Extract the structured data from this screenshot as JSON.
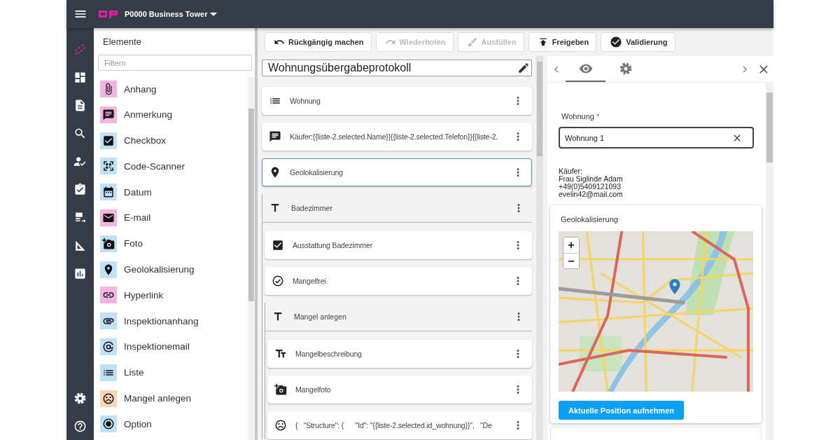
{
  "topbar": {
    "project": "P0000 Business Tower"
  },
  "rail": {
    "items": [
      {
        "kind": "elements",
        "selected": true
      },
      {
        "kind": "dashboard",
        "selected": false
      },
      {
        "kind": "document",
        "selected": false
      },
      {
        "kind": "search-doc",
        "selected": false
      },
      {
        "kind": "person-check",
        "selected": false
      },
      {
        "kind": "clipboard-check",
        "selected": false
      },
      {
        "kind": "list-export",
        "selected": false
      },
      {
        "kind": "ruler",
        "selected": false
      },
      {
        "kind": "chart",
        "selected": false
      }
    ],
    "bottom": [
      {
        "kind": "settings",
        "selected": false
      },
      {
        "kind": "help",
        "selected": false
      }
    ]
  },
  "palette": {
    "title": "Elemente",
    "filter_placeholder": "Filtern",
    "items": [
      {
        "kind": "attach",
        "label": "Anhang",
        "color": "#f4b4e0"
      },
      {
        "kind": "comment",
        "label": "Anmerkung",
        "color": "#f4b4e0"
      },
      {
        "kind": "checkbox",
        "label": "Checkbox",
        "color": "#bfe2fa"
      },
      {
        "kind": "qr",
        "label": "Code-Scanner",
        "color": "#bfe2fa"
      },
      {
        "kind": "calendar",
        "label": "Datum",
        "color": "#bfe2fa"
      },
      {
        "kind": "mail",
        "label": "E-mail",
        "color": "#f4b4e0"
      },
      {
        "label": "Foto",
        "color": "#bfe2fa"
      },
      {
        "kind": "location",
        "label": "Geolokalisierung",
        "color": "#bfe2fa"
      },
      {
        "kind": "link",
        "label": "Hyperlink",
        "color": "#f4b4e0"
      },
      {
        "kind": "attach2",
        "label": "Inspektionanhang",
        "color": "#bfe2fa"
      },
      {
        "kind": "at",
        "label": "Inspektionemail",
        "color": "#bfe2fa"
      },
      {
        "kind": "list",
        "label": "Liste",
        "color": "#bfe2fa"
      },
      {
        "kind": "sad",
        "label": "Mangel anlegen",
        "color": "#ffd4b6"
      },
      {
        "kind": "radio",
        "label": "Option",
        "color": "#bfe2fa"
      }
    ]
  },
  "toolbar": [
    {
      "kind": "undo",
      "label": "Rückgängig machen",
      "disabled": false
    },
    {
      "kind": "redo",
      "label": "Wiederholen",
      "disabled": true
    },
    {
      "kind": "fill",
      "label": "Ausfüllen",
      "disabled": true
    },
    {
      "kind": "publish",
      "label": "Freigeben",
      "disabled": false
    },
    {
      "kind": "validate",
      "label": "Validierung",
      "disabled": false
    }
  ],
  "editor": {
    "form_title": "Wohnungsübergabeprotokoll",
    "fields": [
      {
        "kind": "list",
        "label": "Wohnung",
        "selected": false
      },
      {
        "kind": "comment",
        "label": "Käufer:{{liste-2.selected.Name}}{{liste-2.selected.Telefon}}{{liste-2.",
        "selected": false
      },
      {
        "kind": "location",
        "label": "Geolokalisierung",
        "selected": true
      },
      {
        "kind": "title",
        "label": "Badezimmer",
        "selected": false,
        "children": [
          {
            "kind": "checkbox",
            "label": "Ausstattung Badezimmer",
            "selected": false
          },
          {
            "kind": "check",
            "label": "Mangelfrei",
            "selected": false
          },
          {
            "kind": "title",
            "label": "Mangel anlegen",
            "selected": false,
            "children": [
              {
                "kind": "text",
                "label": "Mangelbeschreibung",
                "selected": false
              },
              {
                "label": "Mangelfoto",
                "selected": false
              },
              {
                "kind": "sad",
                "label": "{   \"Structure\": {      \"Id\": \"{{liste-2.selected.id_wohnung}}\",   \"De",
                "selected": false
              }
            ]
          }
        ]
      }
    ]
  },
  "preview": {
    "tabs": [
      {
        "kind": "eye",
        "selected": true
      },
      {
        "kind": "settings",
        "selected": false
      }
    ],
    "field": {
      "label": "Wohnung",
      "required_mark": "*",
      "value": "Wohnung 1"
    },
    "buyer_info": [
      "Käufer:",
      "Frau Siglinde Adam",
      "+49(0)5409121093",
      "evelin42@mail.com"
    ],
    "geo_card": {
      "title": "Geolokalisierung",
      "zoom_in": "+",
      "zoom_out": "−",
      "button": "Aktuelle Position aufnehmen"
    }
  }
}
